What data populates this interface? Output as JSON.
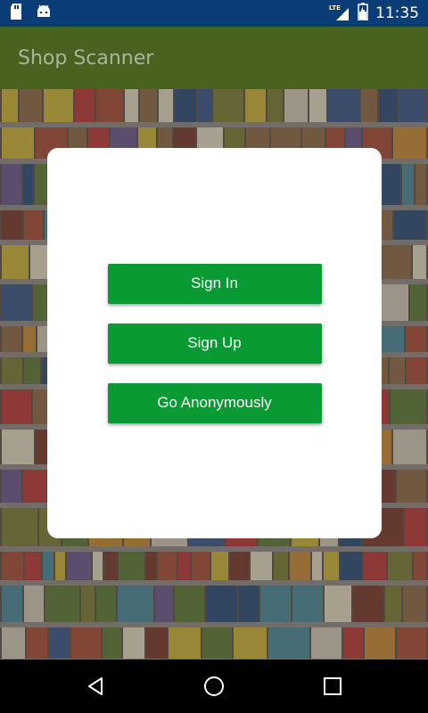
{
  "status_bar": {
    "time": "11:35",
    "network_label": "LTE",
    "icons": [
      "sd-card-icon",
      "android-icon",
      "signal-icon",
      "battery-icon"
    ]
  },
  "app_bar": {
    "title": "Shop Scanner"
  },
  "dialog": {
    "sign_in_label": "Sign In",
    "sign_up_label": "Sign Up",
    "anonymous_label": "Go Anonymously"
  },
  "nav_bar": {
    "icons": [
      "back-icon",
      "home-icon",
      "recents-icon"
    ]
  },
  "colors": {
    "status_bar": "#0a3c78",
    "app_bar": "#4a6220",
    "button": "#0a9a34"
  }
}
